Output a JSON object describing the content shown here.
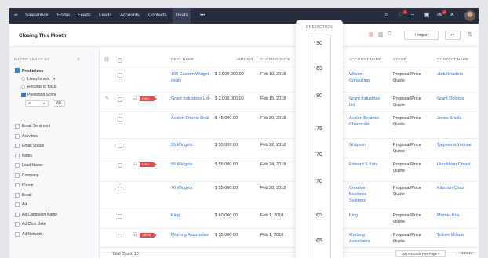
{
  "topbar": {
    "menu_icon": "hamburger-icon",
    "app_name": "SalesInbox",
    "nav": [
      "Home",
      "Feeds",
      "Leads",
      "Accounts",
      "Contacts",
      "Deals"
    ],
    "more": "•••",
    "active_nav": "Deals",
    "icons": [
      "search-icon",
      "bell-icon",
      "plus-icon",
      "calendar-icon",
      "mail-icon",
      "tools-icon"
    ]
  },
  "subbar": {
    "view_label": "Closing This Month",
    "import_label": "Import",
    "more_label": "•••"
  },
  "sidebar": {
    "filter_title": "FILTER LEADS BY",
    "predictions": {
      "label": "Predictions",
      "options": [
        "Likely to win",
        "Records to focus",
        "Prediction Score"
      ],
      "score_operator": ">",
      "score_value": "60"
    },
    "fields": [
      "Email Sentiment",
      "Activities",
      "Email Status",
      "Notes",
      "Lead Name",
      "Company",
      "Phone",
      "Email",
      "Ad",
      "Ad Campaign Name",
      "Ad Click Date",
      "Ad Network"
    ]
  },
  "table": {
    "headers": [
      "DEAL NAME",
      "AMOUNT",
      "CLOSING DATE",
      "ACCOUNT NAME",
      "STAGE",
      "CONTACT NAME"
    ],
    "rows": [
      {
        "deal": "100 Custom Widget deals",
        "amount": "$ 3,000,000.00",
        "date": "Feb 10, 2018",
        "account": "Wilson Consulting",
        "stage": "Proposal/Price Quote",
        "contact": "abdulkhaders",
        "tag": ""
      },
      {
        "deal": "Grant Industries Ltd-",
        "amount": "$ 2,000,000.00",
        "date": "Feb 15, 2018",
        "account": "Grant Industries Ltd",
        "stage": "Proposal/Price Quote",
        "contact": "Grant Doloros",
        "tag": "FEB 1"
      },
      {
        "deal": "Avalon Chems Deal",
        "amount": "$ 45,000.00",
        "date": "Feb 20, 2018",
        "account": "Avalon Beatrice Chemicals",
        "stage": "Proposal/Price Quote",
        "contact": "Jones Sheila",
        "tag": ""
      },
      {
        "deal": "55 Widgets",
        "amount": "$ 55,000.00",
        "date": "Feb 22, 2018",
        "account": "Grayson",
        "stage": "Proposal/Price Quote",
        "contact": "Tjepkema Yvonne",
        "tag": ""
      },
      {
        "deal": "85 Widgets",
        "amount": "$ 55,000.00",
        "date": "Feb 24, 2018",
        "account": "Edward S Katz",
        "stage": "Proposal/Price Quote",
        "contact": "Haroldson Cheryl",
        "tag": "FEB 1"
      },
      {
        "deal": "70 Widgets",
        "amount": "$ 55,000.00",
        "date": "Feb 28, 2018",
        "account": "Creative Business Systems",
        "stage": "Proposal/Price Quote",
        "contact": "Kitzman Chau",
        "tag": ""
      },
      {
        "deal": "King",
        "amount": "$ 60,000.00",
        "date": "Feb 1, 2018",
        "account": "King",
        "stage": "Proposal/Price Quote",
        "contact": "Marrier Kris",
        "tag": ""
      },
      {
        "deal": "Morlong Associates",
        "amount": "$ 35,000.00",
        "date": "Feb 1, 2018",
        "account": "Morlong Associates",
        "stage": "Proposal/Price Quote",
        "contact": "Tollner Mitsue",
        "tag": "JAN 31"
      }
    ]
  },
  "prediction": {
    "header": "PREDICTION",
    "values": [
      "90",
      "85",
      "80",
      "75",
      "70",
      "70",
      "65",
      "65"
    ]
  },
  "footer": {
    "total": "Total Count: 10",
    "per_page": "100 Records Per Page",
    "range": "1 to 10"
  },
  "colors": {
    "topbar": "#272d3f",
    "link": "#2f6fd0",
    "tag": "#e24b4b",
    "checkbox_on": "#3a7bd5"
  }
}
